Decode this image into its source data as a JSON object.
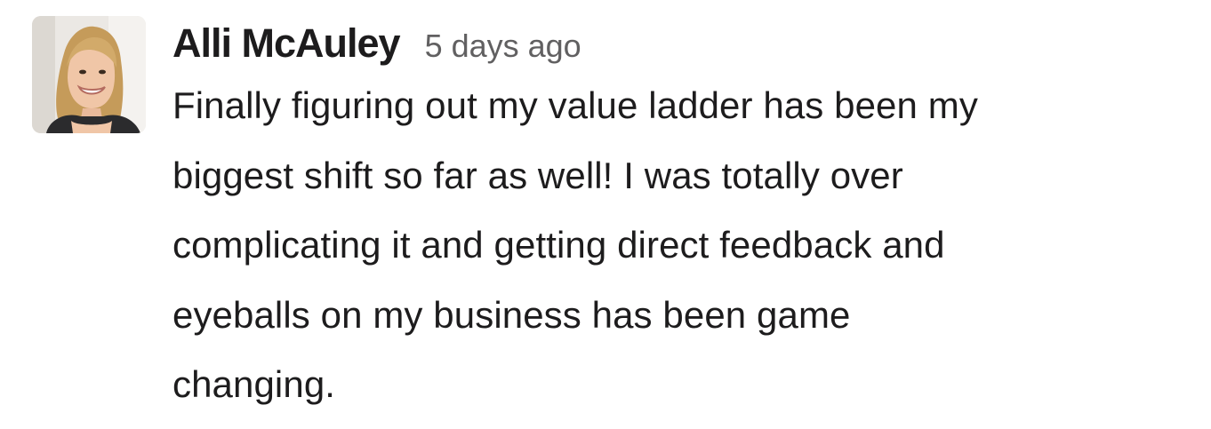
{
  "message": {
    "author": "Alli McAuley",
    "timestamp": "5 days ago",
    "avatar_icon": "user-avatar-photo",
    "text_lines": [
      "Finally figuring out my value ladder has been my",
      "biggest shift so far as well! I was totally over",
      "complicating it and getting direct feedback and",
      "eyeballs on my business has been game",
      "changing."
    ]
  }
}
